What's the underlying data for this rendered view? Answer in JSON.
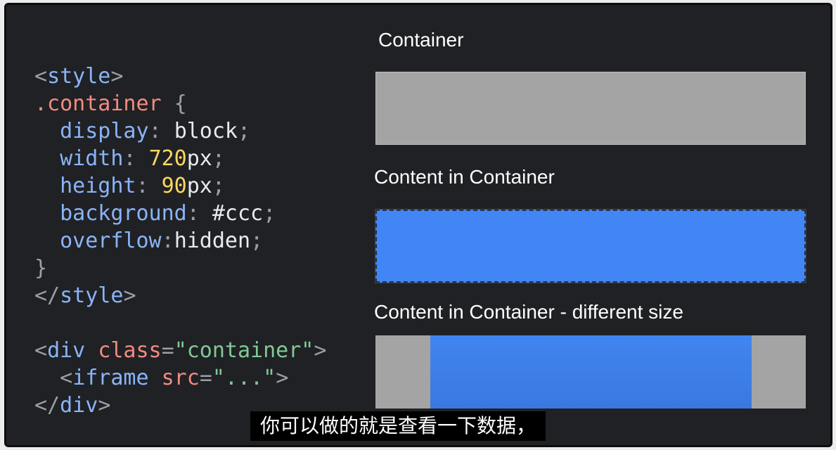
{
  "code_lines": [
    [
      {
        "t": "<",
        "c": "punct"
      },
      {
        "t": "style",
        "c": "tag"
      },
      {
        "t": ">",
        "c": "punct"
      }
    ],
    [
      {
        "t": ".container",
        "c": "selector"
      },
      {
        "t": " {",
        "c": "punct"
      }
    ],
    [
      {
        "t": "  display",
        "c": "prop"
      },
      {
        "t": ": ",
        "c": "punct"
      },
      {
        "t": "block",
        "c": "value"
      },
      {
        "t": ";",
        "c": "punct"
      }
    ],
    [
      {
        "t": "  width",
        "c": "prop"
      },
      {
        "t": ": ",
        "c": "punct"
      },
      {
        "t": "720",
        "c": "num"
      },
      {
        "t": "px",
        "c": "value"
      },
      {
        "t": ";",
        "c": "punct"
      }
    ],
    [
      {
        "t": "  height",
        "c": "prop"
      },
      {
        "t": ": ",
        "c": "punct"
      },
      {
        "t": "90",
        "c": "num"
      },
      {
        "t": "px",
        "c": "value"
      },
      {
        "t": ";",
        "c": "punct"
      }
    ],
    [
      {
        "t": "  background",
        "c": "prop"
      },
      {
        "t": ": ",
        "c": "punct"
      },
      {
        "t": "#ccc",
        "c": "value"
      },
      {
        "t": ";",
        "c": "punct"
      }
    ],
    [
      {
        "t": "  overflow",
        "c": "prop"
      },
      {
        "t": ":",
        "c": "punct"
      },
      {
        "t": "hidden",
        "c": "value"
      },
      {
        "t": ";",
        "c": "punct"
      }
    ],
    [
      {
        "t": "}",
        "c": "punct"
      }
    ],
    [
      {
        "t": "</",
        "c": "punct"
      },
      {
        "t": "style",
        "c": "tag"
      },
      {
        "t": ">",
        "c": "punct"
      }
    ],
    [],
    [
      {
        "t": "<",
        "c": "punct"
      },
      {
        "t": "div",
        "c": "tag"
      },
      {
        "t": " ",
        "c": "value"
      },
      {
        "t": "class",
        "c": "attr"
      },
      {
        "t": "=",
        "c": "punct"
      },
      {
        "t": "\"container\"",
        "c": "string"
      },
      {
        "t": ">",
        "c": "punct"
      }
    ],
    [
      {
        "t": "  <",
        "c": "punct"
      },
      {
        "t": "iframe",
        "c": "tag"
      },
      {
        "t": " ",
        "c": "value"
      },
      {
        "t": "src",
        "c": "attr"
      },
      {
        "t": "=",
        "c": "punct"
      },
      {
        "t": "\"...\"",
        "c": "string"
      },
      {
        "t": ">",
        "c": "punct"
      }
    ],
    [
      {
        "t": "</",
        "c": "punct"
      },
      {
        "t": "div",
        "c": "tag"
      },
      {
        "t": ">",
        "c": "punct"
      }
    ]
  ],
  "headings": {
    "container": "Container",
    "content_in_container": "Content in Container",
    "content_different_size": "Content in Container - different size"
  },
  "subtitle": "你可以做的就是查看一下数据，",
  "colors": {
    "gray_box": "#a4a4a4",
    "blue_content": "#4285f4",
    "background": "#202124"
  }
}
